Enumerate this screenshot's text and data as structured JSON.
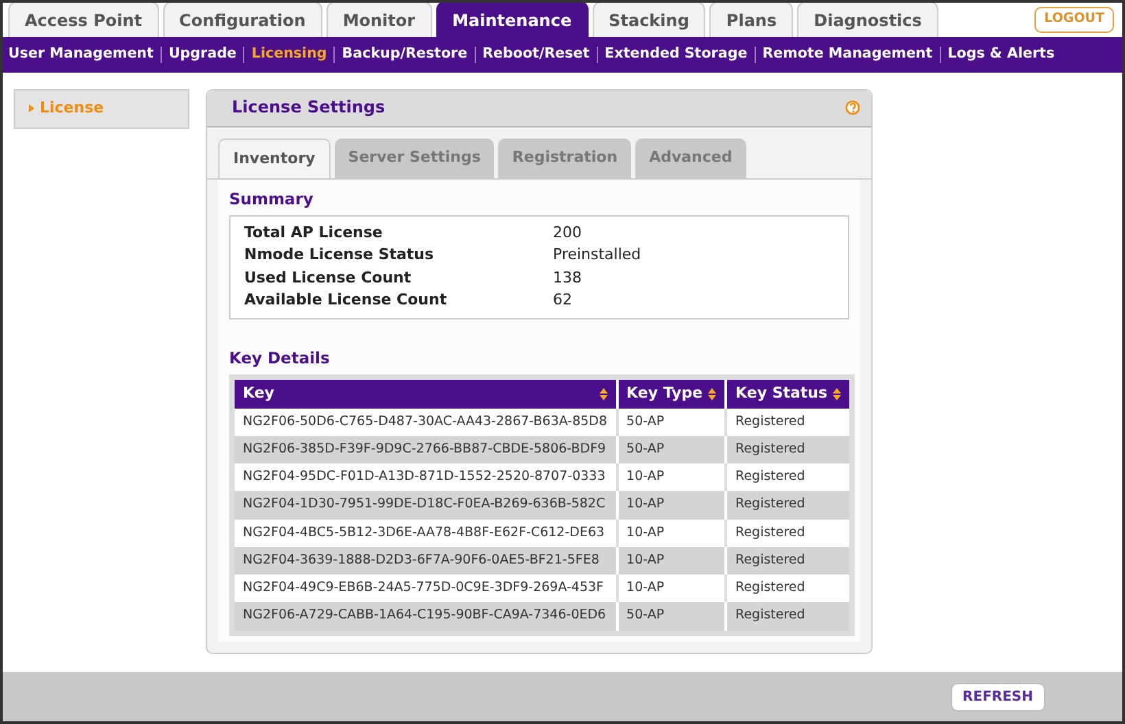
{
  "main_tabs": [
    {
      "label": "Access Point",
      "selected": false
    },
    {
      "label": "Configuration",
      "selected": false
    },
    {
      "label": "Monitor",
      "selected": false
    },
    {
      "label": "Maintenance",
      "selected": true
    },
    {
      "label": "Stacking",
      "selected": false
    },
    {
      "label": "Plans",
      "selected": false
    },
    {
      "label": "Diagnostics",
      "selected": false
    }
  ],
  "logout_button": "LOGOUT",
  "sub_menu": [
    {
      "label": "User Management",
      "selected": false
    },
    {
      "label": "Upgrade",
      "selected": false
    },
    {
      "label": "Licensing",
      "selected": true
    },
    {
      "label": "Backup/Restore",
      "selected": false
    },
    {
      "label": "Reboot/Reset",
      "selected": false
    },
    {
      "label": "Extended Storage",
      "selected": false
    },
    {
      "label": "Remote Management",
      "selected": false
    },
    {
      "label": "Logs & Alerts",
      "selected": false
    }
  ],
  "sidebar": {
    "items": [
      {
        "label": "License",
        "selected": true
      }
    ]
  },
  "panel": {
    "title": "License Settings",
    "tabs": [
      {
        "label": "Inventory",
        "selected": true
      },
      {
        "label": "Server Settings",
        "selected": false
      },
      {
        "label": "Registration",
        "selected": false
      },
      {
        "label": "Advanced",
        "selected": false
      }
    ],
    "summary": {
      "title": "Summary",
      "rows": [
        {
          "label": "Total AP License",
          "value": "200"
        },
        {
          "label": "Nmode License Status",
          "value": "Preinstalled"
        },
        {
          "label": "Used License Count",
          "value": "138"
        },
        {
          "label": "Available License Count",
          "value": "62"
        }
      ]
    },
    "key_details": {
      "title": "Key Details",
      "columns": [
        "Key",
        "Key Type",
        "Key Status"
      ],
      "rows": [
        [
          "NG2F06-50D6-C765-D487-30AC-AA43-2867-B63A-85D8",
          "50-AP",
          "Registered"
        ],
        [
          "NG2F06-385D-F39F-9D9C-2766-BB87-CBDE-5806-BDF9",
          "50-AP",
          "Registered"
        ],
        [
          "NG2F04-95DC-F01D-A13D-871D-1552-2520-8707-0333",
          "10-AP",
          "Registered"
        ],
        [
          "NG2F04-1D30-7951-99DE-D18C-F0EA-B269-636B-582C",
          "10-AP",
          "Registered"
        ],
        [
          "NG2F04-4BC5-5B12-3D6E-AA78-4B8F-E62F-C612-DE63",
          "10-AP",
          "Registered"
        ],
        [
          "NG2F04-3639-1888-D2D3-6F7A-90F6-0AE5-BF21-5FE8",
          "10-AP",
          "Registered"
        ],
        [
          "NG2F04-49C9-EB6B-24A5-775D-0C9E-3DF9-269A-453F",
          "10-AP",
          "Registered"
        ],
        [
          "NG2F06-A729-CABB-1A64-C195-90BF-CA9A-7346-0ED6",
          "50-AP",
          "Registered"
        ]
      ]
    }
  },
  "refresh_button": "REFRESH"
}
